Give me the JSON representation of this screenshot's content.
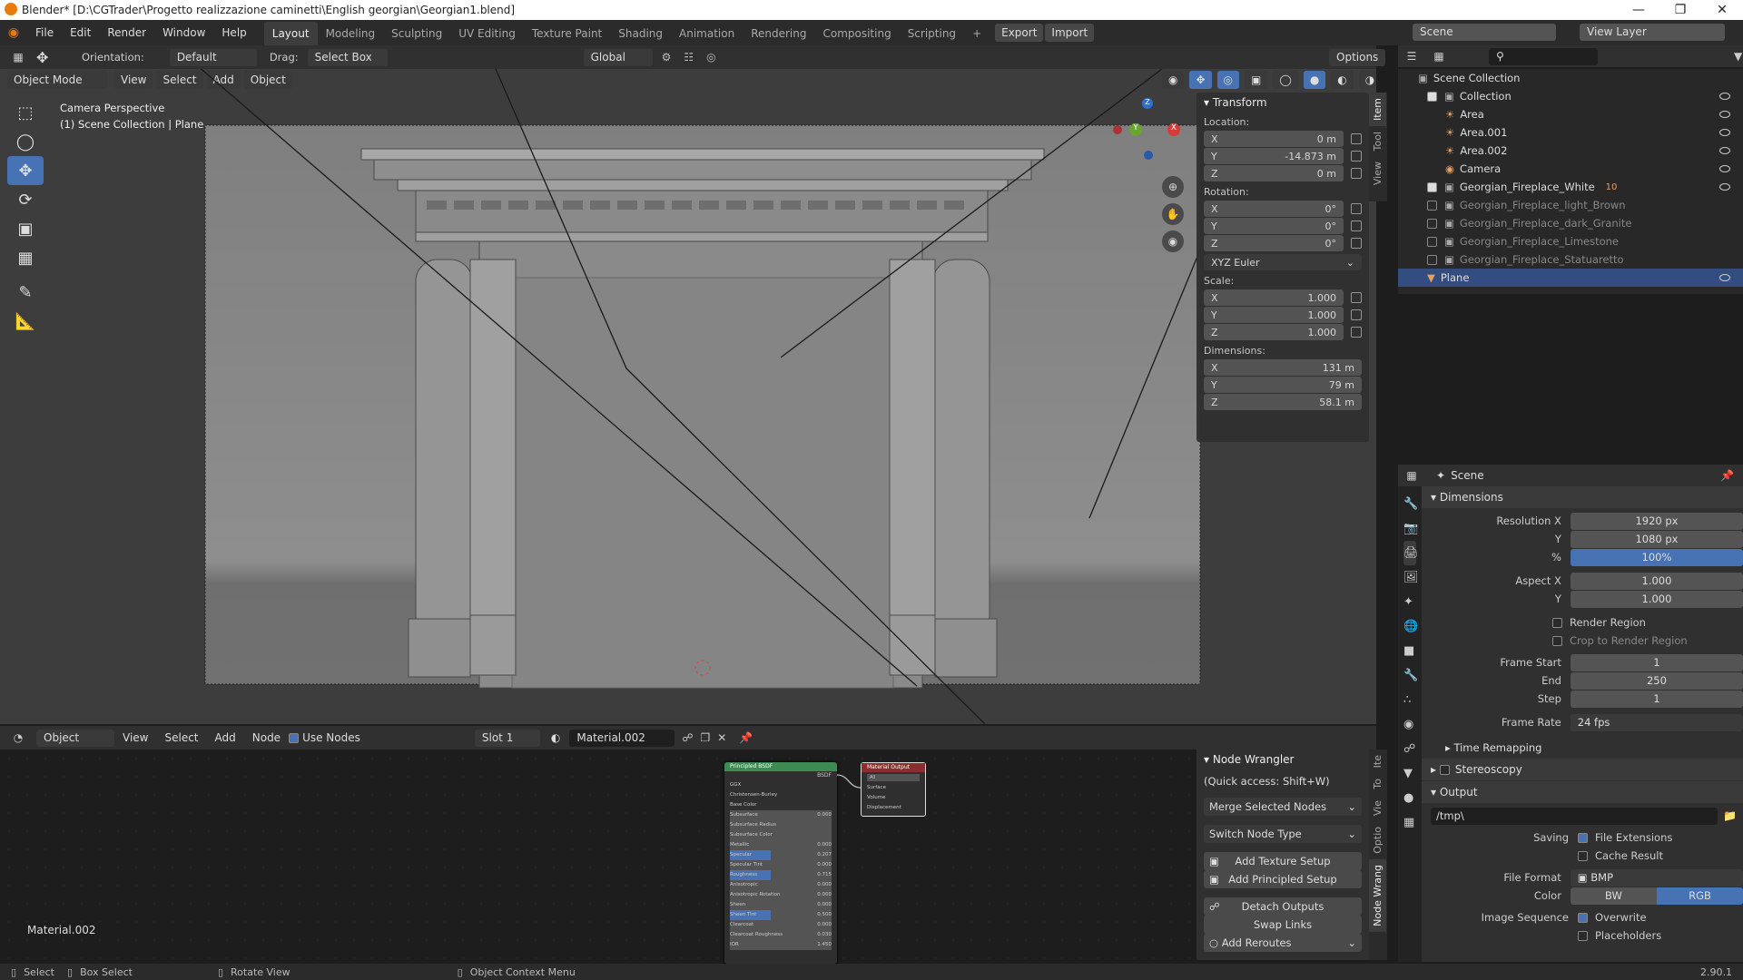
{
  "window": {
    "title": "Blender* [D:\\CGTrader\\Progetto realizzazione caminetti\\English georgian\\Georgian1.blend]"
  },
  "menubar": {
    "items": [
      "File",
      "Edit",
      "Render",
      "Window",
      "Help"
    ],
    "tabs": [
      "Layout",
      "Modeling",
      "Sculpting",
      "UV Editing",
      "Texture Paint",
      "Shading",
      "Animation",
      "Rendering",
      "Compositing",
      "Scripting"
    ],
    "export_label": "Export",
    "import_label": "Import",
    "scene": "Scene",
    "view_layer": "View Layer"
  },
  "viewport_header": {
    "orientation_label": "Orientation:",
    "orientation_value": "Default",
    "drag_label": "Drag:",
    "drag_value": "Select Box",
    "transform_space": "Global",
    "options": "Options",
    "mode": "Object Mode",
    "view": "View",
    "select": "Select",
    "add": "Add",
    "object": "Object"
  },
  "viewport": {
    "camera_label": "Camera Perspective",
    "collection_label": "(1) Scene Collection | Plane"
  },
  "npanel": {
    "title": "Transform",
    "location_label": "Location:",
    "location": [
      {
        "axis": "X",
        "value": "0 m"
      },
      {
        "axis": "Y",
        "value": "-14.873 m"
      },
      {
        "axis": "Z",
        "value": "0 m"
      }
    ],
    "rotation_label": "Rotation:",
    "rotation": [
      {
        "axis": "X",
        "value": "0°"
      },
      {
        "axis": "Y",
        "value": "0°"
      },
      {
        "axis": "Z",
        "value": "0°"
      }
    ],
    "rotation_mode": "XYZ Euler",
    "scale_label": "Scale:",
    "scale": [
      {
        "axis": "X",
        "value": "1.000"
      },
      {
        "axis": "Y",
        "value": "1.000"
      },
      {
        "axis": "Z",
        "value": "1.000"
      }
    ],
    "dimensions_label": "Dimensions:",
    "dimensions": [
      {
        "axis": "X",
        "value": "131 m"
      },
      {
        "axis": "Y",
        "value": "79 m"
      },
      {
        "axis": "Z",
        "value": "58.1 m"
      }
    ],
    "tabs": [
      "Item",
      "Tool",
      "View"
    ]
  },
  "outliner": {
    "root": "Scene Collection",
    "rows": [
      {
        "name": "Collection",
        "indent": 1
      },
      {
        "name": "Area",
        "indent": 2
      },
      {
        "name": "Area.001",
        "indent": 2
      },
      {
        "name": "Area.002",
        "indent": 2
      },
      {
        "name": "Camera",
        "indent": 2
      },
      {
        "name": "Georgian_Fireplace_White",
        "indent": 1
      },
      {
        "name": "Georgian_Fireplace_light_Brown",
        "indent": 1
      },
      {
        "name": "Georgian_Fireplace_dark_Granite",
        "indent": 1
      },
      {
        "name": "Georgian_Fireplace_Limestone",
        "indent": 1
      },
      {
        "name": "Georgian_Fireplace_Statuaretto",
        "indent": 1
      },
      {
        "name": "Plane",
        "indent": 1
      }
    ],
    "modifier_count": "10"
  },
  "properties": {
    "context": "Scene",
    "dimensions_section": "Dimensions",
    "res_x_label": "Resolution X",
    "res_x": "1920 px",
    "res_y_label": "Y",
    "res_y": "1080 px",
    "pct_label": "%",
    "pct": "100%",
    "aspect_x_label": "Aspect X",
    "aspect_x": "1.000",
    "aspect_y_label": "Y",
    "aspect_y": "1.000",
    "render_region": "Render Region",
    "crop_region": "Crop to Render Region",
    "frame_start_label": "Frame Start",
    "frame_start": "1",
    "frame_end_label": "End",
    "frame_end": "250",
    "frame_step_label": "Step",
    "frame_step": "1",
    "frame_rate_label": "Frame Rate",
    "frame_rate": "24 fps",
    "time_remapping": "Time Remapping",
    "stereoscopy": "Stereoscopy",
    "output_section": "Output",
    "output_path": "/tmp\\",
    "saving_label": "Saving",
    "file_extensions": "File Extensions",
    "cache_result": "Cache Result",
    "file_format_label": "File Format",
    "file_format": "BMP",
    "color_label": "Color",
    "color_bw": "BW",
    "color_rgb": "RGB",
    "image_sequence_label": "Image Sequence",
    "overwrite": "Overwrite",
    "placeholders": "Placeholders"
  },
  "node_editor": {
    "header": {
      "object": "Object",
      "view": "View",
      "select": "Select",
      "add": "Add",
      "node": "Node",
      "use_nodes": "Use Nodes",
      "slot": "Slot 1",
      "material": "Material.002"
    },
    "material_label": "Material.002",
    "bsdf_title": "Principled BSDF",
    "bsdf_sub": "BSDF",
    "output_title": "Material Output",
    "output_target": "All",
    "output_sockets": [
      "Surface",
      "Volume",
      "Displacement"
    ],
    "bsdf_rows": [
      "GGX",
      "Christensen-Burley",
      "Base Color",
      "Subsurface",
      "Subsurface Radius",
      "Subsurface Color",
      "Metallic",
      "Specular",
      "Specular Tint",
      "Roughness",
      "Anisotropic",
      "Anisotropic Rotation",
      "Sheen",
      "Sheen Tint",
      "Clearcoat",
      "Clearcoat Roughness",
      "IOR"
    ],
    "bsdf_values": [
      "",
      "",
      "",
      "0.000",
      "",
      "",
      "0.000",
      "0.207",
      "0.000",
      "0.715",
      "0.000",
      "0.000",
      "0.000",
      "0.500",
      "0.000",
      "0.030",
      "1.450"
    ]
  },
  "node_wrangler": {
    "title": "Node Wrangler",
    "quick_access": "(Quick access: Shift+W)",
    "merge": "Merge Selected Nodes",
    "switch": "Switch Node Type",
    "add_texture": "Add Texture Setup",
    "add_principled": "Add Principled Setup",
    "detach": "Detach Outputs",
    "swap": "Swap Links",
    "reroutes": "Add Reroutes",
    "tabs": [
      "Ite",
      "To",
      "Vie",
      "Optio",
      "Node Wrang"
    ]
  },
  "statusbar": {
    "select": "Select",
    "box_select": "Box Select",
    "rotate": "Rotate View",
    "context": "Object Context Menu",
    "version": "2.90.1"
  }
}
